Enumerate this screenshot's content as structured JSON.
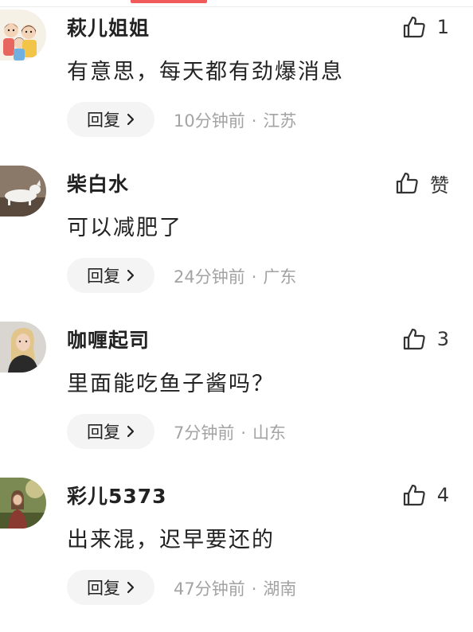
{
  "accent_color": "#f05a5a",
  "comments": [
    {
      "username": "萩儿姐姐",
      "text": "有意思，每天都有劲爆消息",
      "like_label": "1",
      "reply_label": "回复",
      "time": "10分钟前",
      "location": "江苏",
      "avatar_icon": "cartoon-family-avatar"
    },
    {
      "username": "柴白水",
      "text": "可以减肥了",
      "like_label": "赞",
      "reply_label": "回复",
      "time": "24分钟前",
      "location": "广东",
      "avatar_icon": "white-dog-avatar"
    },
    {
      "username": "咖喱起司",
      "text": "里面能吃鱼子酱吗？",
      "like_label": "3",
      "reply_label": "回复",
      "time": "7分钟前",
      "location": "山东",
      "avatar_icon": "blonde-woman-avatar"
    },
    {
      "username": "彩儿5373",
      "text": "出来混，迟早要还的",
      "like_label": "4",
      "reply_label": "回复",
      "time": "47分钟前",
      "location": "湖南",
      "avatar_icon": "woman-outdoor-avatar"
    }
  ]
}
